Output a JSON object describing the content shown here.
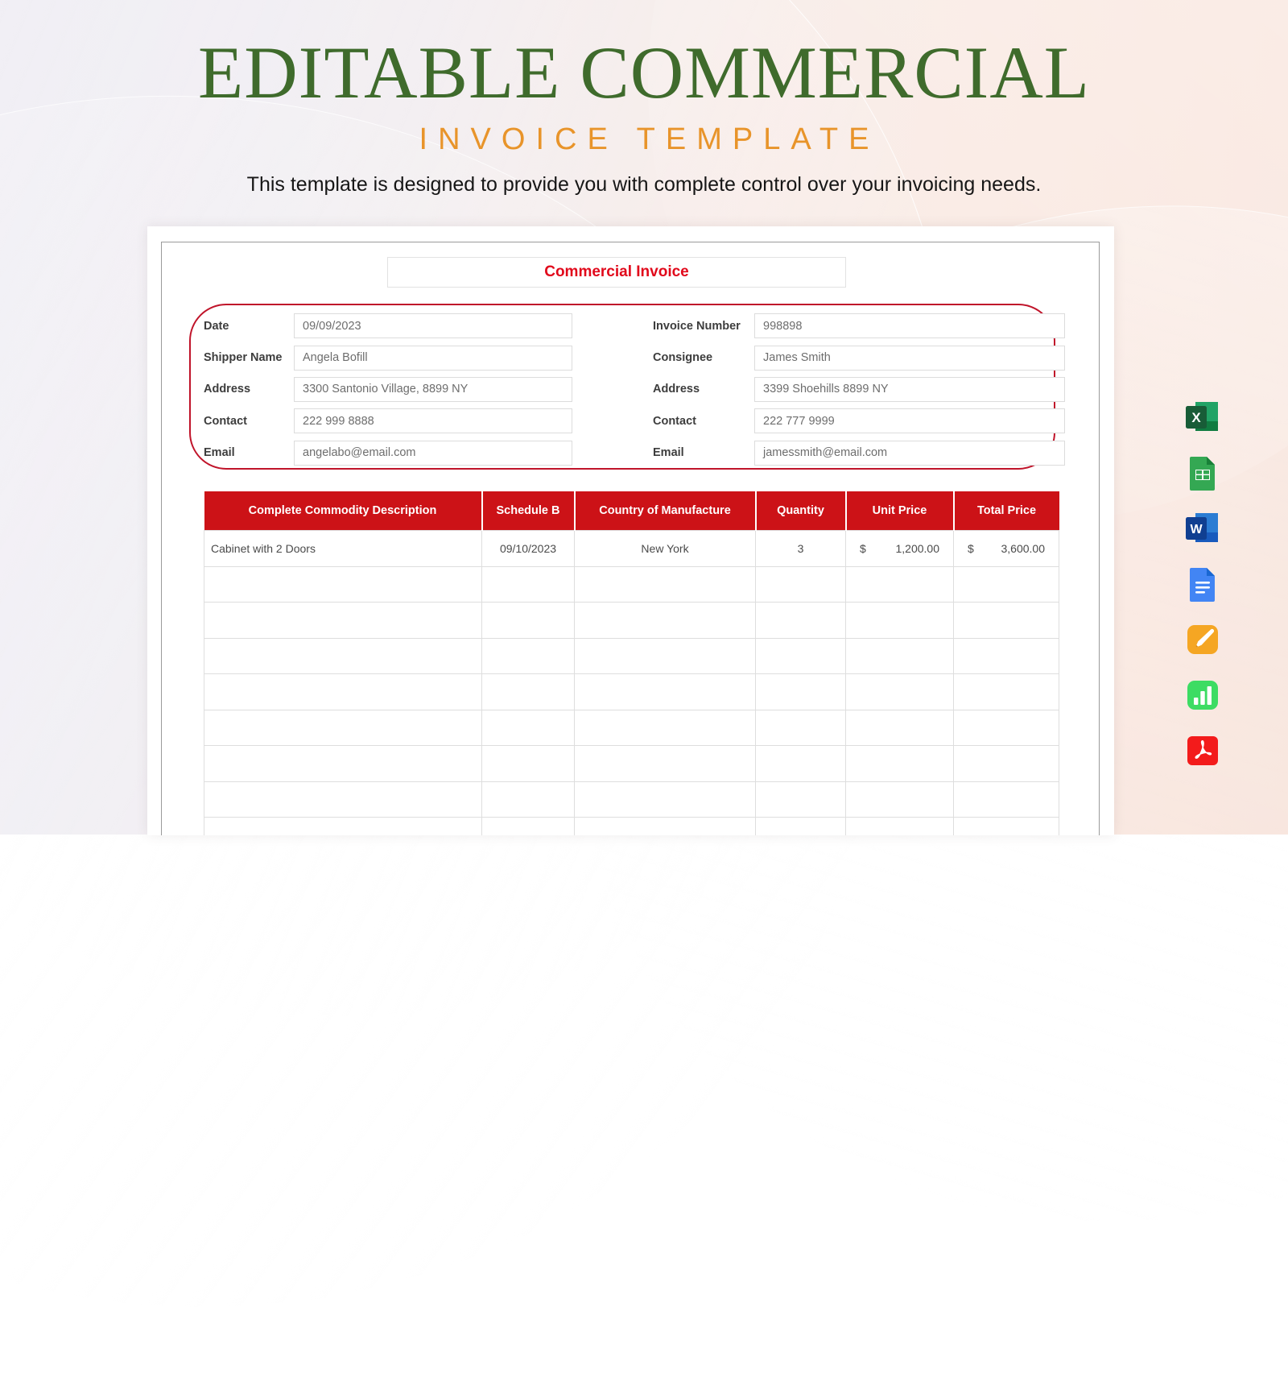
{
  "background": {
    "gradient_left": "#eceaf2",
    "gradient_right": "#f7e3da"
  },
  "header": {
    "title_main": "EDITABLE COMMERCIAL",
    "title_main_color": "#3f6b2c",
    "title_sub": "INVOICE TEMPLATE",
    "title_sub_color": "#e8942a",
    "description": "This template is designed to provide you with complete control over your invoicing needs."
  },
  "document": {
    "invoice_title": "Commercial Invoice",
    "invoice_title_color": "#e1091b",
    "accent_oval_color": "#c0142a",
    "form": {
      "left": [
        {
          "label": "Date",
          "value": "09/09/2023"
        },
        {
          "label": "Shipper Name",
          "value": "Angela Bofill"
        },
        {
          "label": "Address",
          "value": "3300 Santonio Village, 8899 NY"
        },
        {
          "label": "Contact",
          "value": "222 999 8888"
        },
        {
          "label": "Email",
          "value": "angelabo@email.com"
        }
      ],
      "right": [
        {
          "label": "Invoice Number",
          "value": "998898"
        },
        {
          "label": "Consignee",
          "value": "James Smith"
        },
        {
          "label": "Address",
          "value": "3399 Shoehills 8899 NY"
        },
        {
          "label": "Contact",
          "value": "222 777 9999"
        },
        {
          "label": "Email",
          "value": "jamessmith@email.com"
        }
      ]
    },
    "table": {
      "header_bg": "#cc1217",
      "columns": [
        "Complete Commodity Description",
        "Schedule B",
        "Country of Manufacture",
        "Quantity",
        "Unit Price",
        "Total Price"
      ],
      "rows": [
        {
          "description": "Cabinet with 2 Doors",
          "schedule_b": "09/10/2023",
          "country": "New York",
          "quantity": "3",
          "unit_price_symbol": "$",
          "unit_price": "1,200.00",
          "total_price_symbol": "$",
          "total_price": "3,600.00"
        },
        {
          "description": "",
          "schedule_b": "",
          "country": "",
          "quantity": "",
          "unit_price_symbol": "",
          "unit_price": "",
          "total_price_symbol": "",
          "total_price": ""
        },
        {
          "description": "",
          "schedule_b": "",
          "country": "",
          "quantity": "",
          "unit_price_symbol": "",
          "unit_price": "",
          "total_price_symbol": "",
          "total_price": ""
        },
        {
          "description": "",
          "schedule_b": "",
          "country": "",
          "quantity": "",
          "unit_price_symbol": "",
          "unit_price": "",
          "total_price_symbol": "",
          "total_price": ""
        },
        {
          "description": "",
          "schedule_b": "",
          "country": "",
          "quantity": "",
          "unit_price_symbol": "",
          "unit_price": "",
          "total_price_symbol": "",
          "total_price": ""
        },
        {
          "description": "",
          "schedule_b": "",
          "country": "",
          "quantity": "",
          "unit_price_symbol": "",
          "unit_price": "",
          "total_price_symbol": "",
          "total_price": ""
        },
        {
          "description": "",
          "schedule_b": "",
          "country": "",
          "quantity": "",
          "unit_price_symbol": "",
          "unit_price": "",
          "total_price_symbol": "",
          "total_price": ""
        },
        {
          "description": "",
          "schedule_b": "",
          "country": "",
          "quantity": "",
          "unit_price_symbol": "",
          "unit_price": "",
          "total_price_symbol": "",
          "total_price": ""
        },
        {
          "description": "",
          "schedule_b": "",
          "country": "",
          "quantity": "",
          "unit_price_symbol": "",
          "unit_price": "",
          "total_price_symbol": "",
          "total_price": ""
        }
      ]
    }
  },
  "format_rail": {
    "icons": [
      {
        "name": "excel-icon",
        "label": "Excel",
        "color": "#1d7044"
      },
      {
        "name": "google-sheets-icon",
        "label": "Google Sheets",
        "color": "#34a853"
      },
      {
        "name": "word-icon",
        "label": "Word",
        "color": "#185abd"
      },
      {
        "name": "google-docs-icon",
        "label": "Google Docs",
        "color": "#4285f4"
      },
      {
        "name": "apple-pages-icon",
        "label": "Apple Pages",
        "color": "#f5a623"
      },
      {
        "name": "apple-numbers-icon",
        "label": "Apple Numbers",
        "color": "#3ddc63"
      },
      {
        "name": "pdf-icon",
        "label": "PDF",
        "color": "#f31b1b"
      }
    ]
  }
}
